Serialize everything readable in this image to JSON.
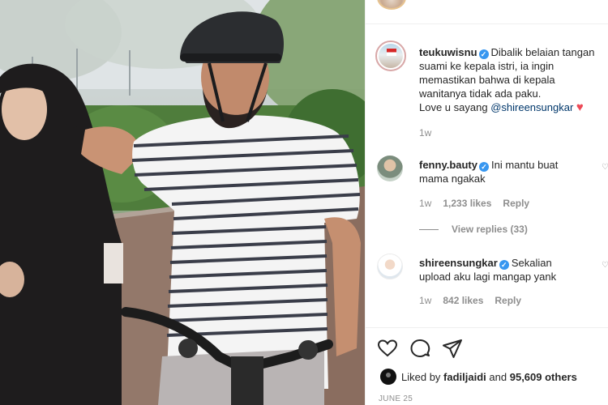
{
  "post": {
    "caption": {
      "username": "teukuwisnu",
      "text": "Dibalik belaian tangan suami ke kepala istri, ia ingin memastikan bahwa di kepala wanitanya tidak ada paku.",
      "text_line1": "Dibalik belaian tangan",
      "text_line2": "suami ke kepala istri, ia ingin",
      "text_line3": "memastikan bahwa di kepala",
      "text_line4": "wanitanya tidak ada paku.",
      "love_prefix": "Love u sayang",
      "mention": "@shireensungkar",
      "time": "1w"
    },
    "comments": [
      {
        "username": "fenny.bauty",
        "text_line1": "Ini mantu buat",
        "text_line2": "mama ngakak",
        "time": "1w",
        "likes": "1,233 likes",
        "reply": "Reply",
        "view_replies": "View replies (33)"
      },
      {
        "username": "shireensungkar",
        "text_line1": "Sekalian",
        "text_line2": "upload aku lagi mangap yank",
        "time": "1w",
        "likes": "842 likes",
        "reply": "Reply"
      }
    ],
    "liked_by": {
      "prefix": "Liked by",
      "user": "fadiljaidi",
      "and": "and",
      "count": "95,609 others"
    },
    "date": "JUNE 25"
  },
  "icons": {
    "like": "heart-outline-icon",
    "comment": "comment-bubble-icon",
    "share": "paper-plane-icon",
    "verified": "verified-badge-icon"
  },
  "colors": {
    "verified": "#3897f0",
    "heart": "#ed4956",
    "mention": "#00376b",
    "meta": "#8e8e8e"
  }
}
